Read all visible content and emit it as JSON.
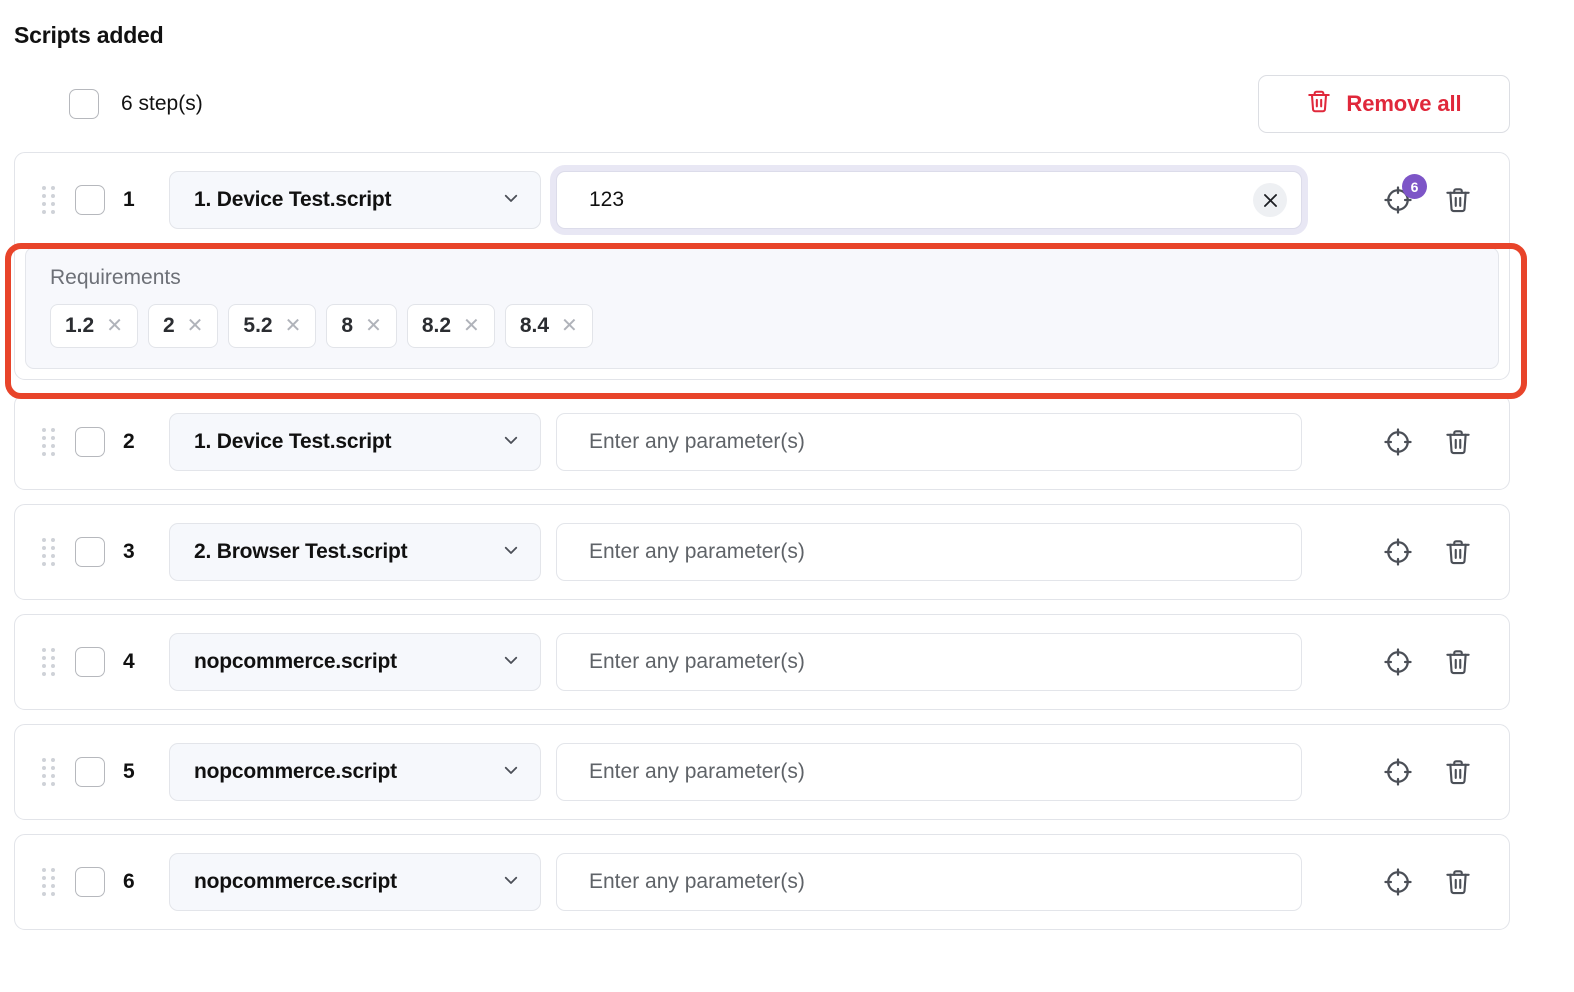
{
  "header": {
    "title": "Scripts added",
    "steps_checkbox_label": "6 step(s)",
    "remove_all_label": "Remove all",
    "trash_icon": "trash-icon"
  },
  "colors": {
    "accent_red": "#e0283b",
    "annotation_red": "#e8442a",
    "badge_purple": "#7d55c7",
    "select_bg": "#f6f8fc",
    "requirements_bg": "#f7f8fc",
    "border": "#e2e4e9"
  },
  "param_placeholder": "Enter any parameter(s)",
  "steps": [
    {
      "index": "1",
      "script": "1. Device Test.script",
      "param_value": "123",
      "param_focused": true,
      "has_clear": true,
      "target_badge": "6",
      "requirements": {
        "label": "Requirements",
        "tags": [
          "1.2",
          "2",
          "5.2",
          "8",
          "8.2",
          "8.4"
        ]
      }
    },
    {
      "index": "2",
      "script": "1. Device Test.script",
      "param_value": "",
      "param_focused": false,
      "has_clear": false,
      "target_badge": "",
      "requirements": null
    },
    {
      "index": "3",
      "script": "2. Browser Test.script",
      "param_value": "",
      "param_focused": false,
      "has_clear": false,
      "target_badge": "",
      "requirements": null
    },
    {
      "index": "4",
      "script": "nopcommerce.script",
      "param_value": "",
      "param_focused": false,
      "has_clear": false,
      "target_badge": "",
      "requirements": null
    },
    {
      "index": "5",
      "script": "nopcommerce.script",
      "param_value": "",
      "param_focused": false,
      "has_clear": false,
      "target_badge": "",
      "requirements": null
    },
    {
      "index": "6",
      "script": "nopcommerce.script",
      "param_value": "",
      "param_focused": false,
      "has_clear": false,
      "target_badge": "",
      "requirements": null
    }
  ],
  "icons": {
    "drag": "drag-handle-icon",
    "chevron": "chevron-down-icon",
    "target": "crosshair-target-icon",
    "delete": "trash-icon",
    "clear": "close-x-icon"
  }
}
